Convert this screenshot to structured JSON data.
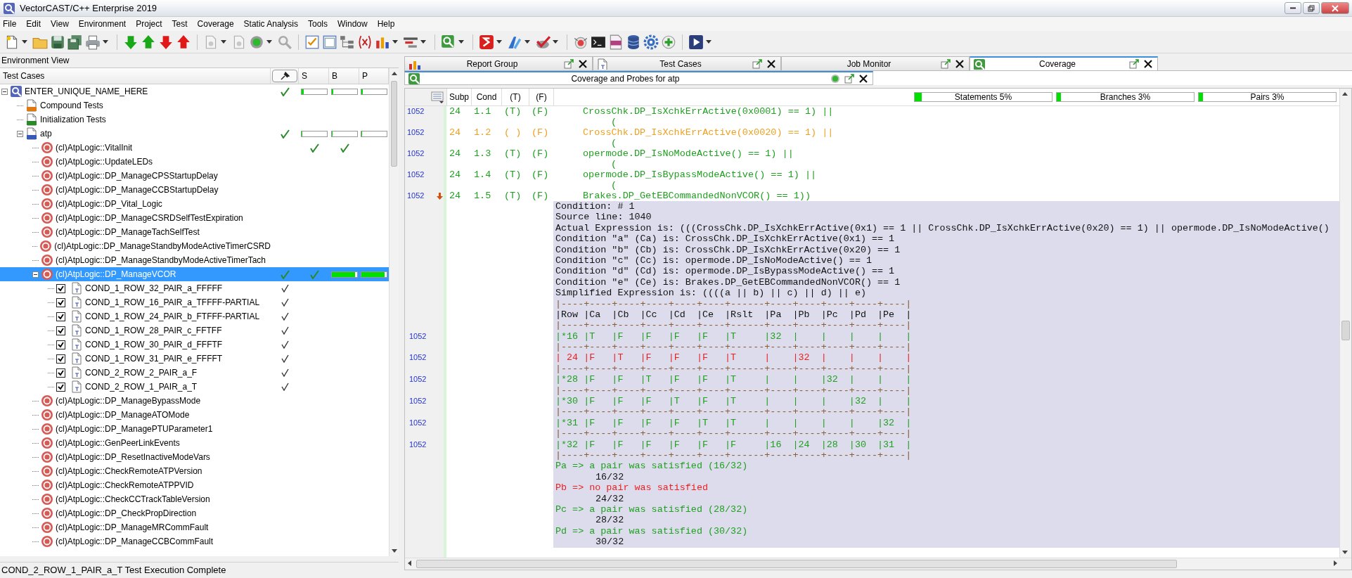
{
  "window": {
    "title": "VectorCAST/C++ Enterprise 2019"
  },
  "menu": [
    "File",
    "Edit",
    "View",
    "Environment",
    "Project",
    "Test",
    "Coverage",
    "Static Analysis",
    "Tools",
    "Window",
    "Help"
  ],
  "environment_view": {
    "title": "Environment View",
    "columns": [
      "Test Cases",
      "S",
      "B",
      "P"
    ],
    "tree": [
      {
        "label": "ENTER_UNIQUE_NAME_HERE",
        "kind": "environment",
        "expanded": true,
        "selected": false,
        "passed": true,
        "s": {
          "kind": "bar",
          "level": 0.1
        },
        "b": {
          "kind": "bar",
          "level": 0.06
        },
        "p": {
          "kind": "bar",
          "level": 0.05
        },
        "children": [
          {
            "label": "Compound Tests",
            "kind": "compound",
            "selected": false
          },
          {
            "label": "Initialization Tests",
            "kind": "init",
            "selected": false
          },
          {
            "label": "atp",
            "kind": "unit",
            "expanded": true,
            "selected": false,
            "passed": true,
            "s": {
              "kind": "bar",
              "level": 0.04
            },
            "b": {
              "kind": "bar",
              "level": 0.03
            },
            "p": {
              "kind": "bar",
              "level": 0.03
            },
            "children": [
              {
                "label": "(cl)AtpLogic::VitalInit",
                "kind": "subprogram",
                "selected": false,
                "s": {
                  "kind": "check"
                },
                "b": {
                  "kind": "check"
                }
              },
              {
                "label": "(cl)AtpLogic::UpdateLEDs",
                "kind": "subprogram",
                "selected": false
              },
              {
                "label": "(cl)AtpLogic::DP_ManageCPSStartupDelay",
                "kind": "subprogram",
                "selected": false
              },
              {
                "label": "(cl)AtpLogic::DP_ManageCCBStartupDelay",
                "kind": "subprogram",
                "selected": false
              },
              {
                "label": "(cl)AtpLogic::DP_Vital_Logic",
                "kind": "subprogram",
                "selected": false
              },
              {
                "label": "(cl)AtpLogic::DP_ManageCSRDSelfTestExpiration",
                "kind": "subprogram",
                "selected": false
              },
              {
                "label": "(cl)AtpLogic::DP_ManageTachSelfTest",
                "kind": "subprogram",
                "selected": false
              },
              {
                "label": "(cl)AtpLogic::DP_ManageStandbyModeActiveTimerCSRD",
                "kind": "subprogram",
                "selected": false
              },
              {
                "label": "(cl)AtpLogic::DP_ManageStandbyModeActiveTimerTach",
                "kind": "subprogram",
                "selected": false
              },
              {
                "label": "(cl)AtpLogic::DP_ManageVCOR",
                "kind": "subprogram",
                "expanded": true,
                "selected": true,
                "passed": true,
                "s": {
                  "kind": "check"
                },
                "b": {
                  "kind": "bar",
                  "level": 0.93
                },
                "p": {
                  "kind": "bar",
                  "level": 0.92
                },
                "children": [
                  {
                    "label": "COND_1_ROW_32_PAIR_a_FFFFF",
                    "kind": "test",
                    "checked": true,
                    "selected": false,
                    "executed": true
                  },
                  {
                    "label": "COND_1_ROW_16_PAIR_a_TFFFF-PARTIAL",
                    "kind": "test",
                    "checked": true,
                    "selected": false,
                    "executed": true
                  },
                  {
                    "label": "COND_1_ROW_24_PAIR_b_FTFFF-PARTIAL",
                    "kind": "test",
                    "checked": true,
                    "selected": false,
                    "executed": true
                  },
                  {
                    "label": "COND_1_ROW_28_PAIR_c_FFTFF",
                    "kind": "test",
                    "checked": true,
                    "selected": false,
                    "executed": true
                  },
                  {
                    "label": "COND_1_ROW_30_PAIR_d_FFFTF",
                    "kind": "test",
                    "checked": true,
                    "selected": false,
                    "executed": true
                  },
                  {
                    "label": "COND_1_ROW_31_PAIR_e_FFFFT",
                    "kind": "test",
                    "checked": true,
                    "selected": false,
                    "executed": true
                  },
                  {
                    "label": "COND_2_ROW_2_PAIR_a_F",
                    "kind": "test",
                    "checked": true,
                    "selected": false,
                    "executed": true
                  },
                  {
                    "label": "COND_2_ROW_1_PAIR_a_T",
                    "kind": "test",
                    "checked": true,
                    "selected": false,
                    "executed": true
                  }
                ]
              },
              {
                "label": "(cl)AtpLogic::DP_ManageBypassMode",
                "kind": "subprogram",
                "selected": false
              },
              {
                "label": "(cl)AtpLogic::DP_ManageATOMode",
                "kind": "subprogram",
                "selected": false
              },
              {
                "label": "(cl)AtpLogic::DP_ManagePTUParameter1",
                "kind": "subprogram",
                "selected": false
              },
              {
                "label": "(cl)AtpLogic::GenPeerLinkEvents",
                "kind": "subprogram",
                "selected": false
              },
              {
                "label": "(cl)AtpLogic::DP_ResetInactiveModeVars",
                "kind": "subprogram",
                "selected": false
              },
              {
                "label": "(cl)AtpLogic::CheckRemoteATPVersion",
                "kind": "subprogram",
                "selected": false
              },
              {
                "label": "(cl)AtpLogic::CheckRemoteATPPVID",
                "kind": "subprogram",
                "selected": false
              },
              {
                "label": "(cl)AtpLogic::CheckCCTrackTableVersion",
                "kind": "subprogram",
                "selected": false
              },
              {
                "label": "(cl)AtpLogic::DP_CheckPropDirection",
                "kind": "subprogram",
                "selected": false
              },
              {
                "label": "(cl)AtpLogic::DP_ManageMRCommFault",
                "kind": "subprogram",
                "selected": false
              },
              {
                "label": "(cl)AtpLogic::DP_ManageCCBCommFault",
                "kind": "subprogram",
                "selected": false
              }
            ]
          }
        ]
      }
    ]
  },
  "status_bar": "COND_2_ROW_1_PAIR_a_T Test Execution Complete",
  "tabs": [
    {
      "label": "Report Group",
      "selected": false
    },
    {
      "label": "Test Cases",
      "selected": false
    },
    {
      "label": "Job Monitor",
      "selected": false
    },
    {
      "label": "Coverage",
      "selected": true
    }
  ],
  "subtab": {
    "label": "Coverage and Probes for atp"
  },
  "columns": [
    "Subp",
    "Cond",
    "(T)",
    "(F)"
  ],
  "summary": [
    {
      "label": "Statements 5%",
      "level": 0.05
    },
    {
      "label": "Branches 3%",
      "level": 0.03
    },
    {
      "label": "Pairs 3%",
      "level": 0.03
    }
  ],
  "code_lines": [
    {
      "kind": "statement",
      "line_no": "1052",
      "current": false,
      "subp": "24",
      "cond": "1.1",
      "t": "(T)",
      "f": "(F)",
      "code": "CrossChk.DP_IsXchkErrActive(0x0001) == 1) ||",
      "color": "#20a020"
    },
    {
      "kind": "continuation",
      "code": "("
    },
    {
      "kind": "statement",
      "line_no": "1052",
      "current": false,
      "subp": "24",
      "cond": "1.2",
      "t": "( )",
      "f": "(F)",
      "code": "CrossChk.DP_IsXchkErrActive(0x0020) == 1) ||",
      "color": "#f0a020"
    },
    {
      "kind": "continuation",
      "code": "("
    },
    {
      "kind": "statement",
      "line_no": "1052",
      "current": false,
      "subp": "24",
      "cond": "1.3",
      "t": "(T)",
      "f": "(F)",
      "code": "opermode.DP_IsNoModeActive() == 1) ||",
      "color": "#20a020"
    },
    {
      "kind": "continuation",
      "code": "("
    },
    {
      "kind": "statement",
      "line_no": "1052",
      "current": false,
      "subp": "24",
      "cond": "1.4",
      "t": "(T)",
      "f": "(F)",
      "code": "opermode.DP_IsBypassModeActive() == 1) ||",
      "color": "#20a020"
    },
    {
      "kind": "continuation",
      "code": "("
    },
    {
      "kind": "statement",
      "line_no": "1052",
      "current": true,
      "subp": "24",
      "cond": "1.5",
      "t": "(T)",
      "f": "(F)",
      "code": "Brakes.DP_GetEBCommandedNonVCOR() == 1))",
      "color": "#20a020"
    }
  ],
  "condition_report": [
    {
      "kind": "text",
      "color": "#111111",
      "text": "Condition: # 1"
    },
    {
      "kind": "text",
      "color": "#111111",
      "text": "Source line: 1040"
    },
    {
      "kind": "text",
      "color": "#111111",
      "text": "Actual Expression is: (((CrossChk.DP_IsXchkErrActive(0x1) == 1 || CrossChk.DP_IsXchkErrActive(0x20) == 1) || opermode.DP_IsNoModeActive()"
    },
    {
      "kind": "text",
      "color": "#111111",
      "text": "Condition \"a\" (Ca) is: CrossChk.DP_IsXchkErrActive(0x1) == 1"
    },
    {
      "kind": "text",
      "color": "#111111",
      "text": "Condition \"b\" (Cb) is: CrossChk.DP_IsXchkErrActive(0x20) == 1"
    },
    {
      "kind": "text",
      "color": "#111111",
      "text": "Condition \"c\" (Cc) is: opermode.DP_IsNoModeActive() == 1"
    },
    {
      "kind": "text",
      "color": "#111111",
      "text": "Condition \"d\" (Cd) is: opermode.DP_IsBypassModeActive() == 1"
    },
    {
      "kind": "text",
      "color": "#111111",
      "text": "Condition \"e\" (Ce) is: Brakes.DP_GetEBCommandedNonVCOR() == 1"
    },
    {
      "kind": "text",
      "color": "#111111",
      "text": "Simplified Expression is: ((((a || b) || c) || d) || e)"
    },
    {
      "kind": "rule",
      "color": "#8a5a30",
      "text": "|----+----+----+----+----+----+------+----+----+----+----+----|"
    },
    {
      "kind": "row",
      "color": "#111111",
      "text": "|Row |Ca  |Cb  |Cc  |Cd  |Ce  |Rslt  |Pa  |Pb  |Pc  |Pd  |Pe  |"
    },
    {
      "kind": "rule",
      "color": "#8a5a30",
      "text": "|----+----+----+----+----+----+------+----+----+----+----+----|"
    },
    {
      "kind": "row",
      "color": "#20a020",
      "line_no": "1052",
      "text": "|*16 |T   |F   |F   |F   |F   |T     |32  |    |    |    |    |"
    },
    {
      "kind": "rule",
      "color": "#8a5a30",
      "text": "|----+----+----+----+----+----+------+----+----+----+----+----|"
    },
    {
      "kind": "row",
      "color": "#ee2020",
      "line_no": "1052",
      "text": "| 24 |F   |T   |F   |F   |F   |T     |    |32  |    |    |    |"
    },
    {
      "kind": "rule",
      "color": "#8a5a30",
      "text": "|----+----+----+----+----+----+------+----+----+----+----+----|"
    },
    {
      "kind": "row",
      "color": "#20a020",
      "line_no": "1052",
      "text": "|*28 |F   |F   |T   |F   |F   |T     |    |    |32  |    |    |"
    },
    {
      "kind": "rule",
      "color": "#8a5a30",
      "text": "|----+----+----+----+----+----+------+----+----+----+----+----|"
    },
    {
      "kind": "row",
      "color": "#20a020",
      "line_no": "1052",
      "text": "|*30 |F   |F   |F   |T   |F   |T     |    |    |    |32  |    |"
    },
    {
      "kind": "rule",
      "color": "#8a5a30",
      "text": "|----+----+----+----+----+----+------+----+----+----+----+----|"
    },
    {
      "kind": "row",
      "color": "#20a020",
      "line_no": "1052",
      "text": "|*31 |F   |F   |F   |F   |T   |T     |    |    |    |    |32  |"
    },
    {
      "kind": "rule",
      "color": "#8a5a30",
      "text": "|----+----+----+----+----+----+------+----+----+----+----+----|"
    },
    {
      "kind": "row",
      "color": "#20a020",
      "line_no": "1052",
      "text": "|*32 |F   |F   |F   |F   |F   |F     |16  |24  |28  |30  |31  |"
    },
    {
      "kind": "rule",
      "color": "#8a5a30",
      "text": "|----+----+----+----+----+----+------+----+----+----+----+----|"
    },
    {
      "kind": "text",
      "color": "#20a020",
      "text": "Pa => a pair was satisfied (16/32)"
    },
    {
      "kind": "detail",
      "color": "#111111",
      "text": "16/32"
    },
    {
      "kind": "text",
      "color": "#ee2020",
      "text": "Pb => no pair was satisfied"
    },
    {
      "kind": "detail",
      "color": "#111111",
      "text": "24/32"
    },
    {
      "kind": "text",
      "color": "#20a020",
      "text": "Pc => a pair was satisfied (28/32)"
    },
    {
      "kind": "detail",
      "color": "#111111",
      "text": "28/32"
    },
    {
      "kind": "text",
      "color": "#20a020",
      "text": "Pd => a pair was satisfied (30/32)"
    },
    {
      "kind": "detail",
      "color": "#111111",
      "text": "30/32"
    }
  ]
}
